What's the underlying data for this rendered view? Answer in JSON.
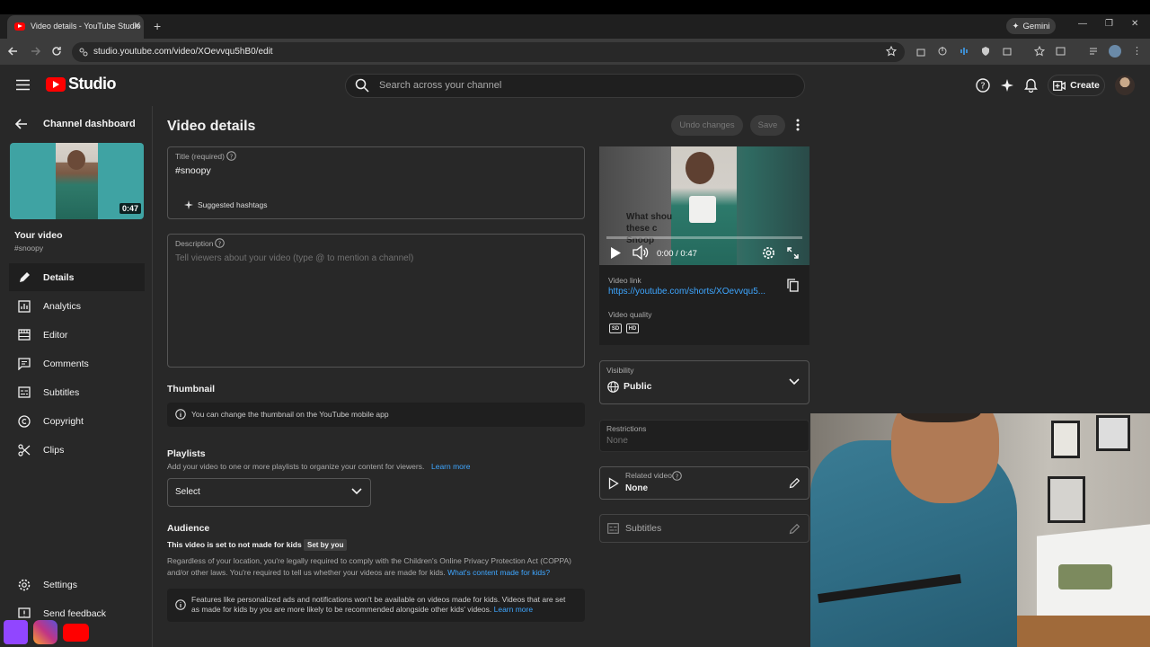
{
  "browser": {
    "tab_title": "Video details - YouTube Studio",
    "url": "studio.youtube.com/video/XOevvqu5hB0/edit",
    "gemini_label": "Gemini"
  },
  "header": {
    "logo_text": "Studio",
    "search_placeholder": "Search across your channel",
    "create_label": "Create"
  },
  "sidebar": {
    "back_label": "Channel dashboard",
    "thumb_duration": "0:47",
    "your_video": "Your video",
    "video_title": "#snoopy",
    "items": [
      {
        "label": "Details",
        "icon": "pencil-icon",
        "active": true
      },
      {
        "label": "Analytics",
        "icon": "analytics-icon"
      },
      {
        "label": "Editor",
        "icon": "editor-icon"
      },
      {
        "label": "Comments",
        "icon": "comments-icon"
      },
      {
        "label": "Subtitles",
        "icon": "subtitles-icon"
      },
      {
        "label": "Copyright",
        "icon": "copyright-icon"
      },
      {
        "label": "Clips",
        "icon": "scissors-icon"
      }
    ],
    "settings": "Settings",
    "feedback": "Send feedback"
  },
  "main": {
    "page_title": "Video details",
    "undo": "Undo changes",
    "save": "Save",
    "title_label": "Title (required)",
    "title_value": "#snoopy",
    "suggested_hashtags": "Suggested hashtags",
    "description_label": "Description",
    "description_placeholder": "Tell viewers about your video (type @ to mention a channel)",
    "thumbnail_heading": "Thumbnail",
    "thumbnail_info": "You can change the thumbnail on the YouTube mobile app",
    "playlists_heading": "Playlists",
    "playlists_desc": "Add your video to one or more playlists to organize your content for viewers.",
    "playlists_learn_more": "Learn more",
    "playlists_select": "Select",
    "audience_heading": "Audience",
    "audience_status": "This video is set to not made for kids",
    "audience_badge": "Set by you",
    "audience_p1": "Regardless of your location, you're legally required to comply with the Children's Online Privacy Protection Act (COPPA) and/or other laws. You're required to tell us whether your videos are made for kids.",
    "audience_p1_link": "What's content made for kids?",
    "audience_info": "Features like personalized ads and notifications won't be available on videos made for kids. Videos that are set as made for kids by you are more likely to be recommended alongside other kids' videos.",
    "audience_info_link": "Learn more"
  },
  "right": {
    "player_time": "0:00 / 0:47",
    "player_caption": "What shou these c Snoop",
    "video_link_label": "Video link",
    "video_link": "https://youtube.com/shorts/XOevvqu5...",
    "video_quality_label": "Video quality",
    "quality_badges": [
      "SD",
      "HD"
    ],
    "visibility_label": "Visibility",
    "visibility_value": "Public",
    "restrictions_label": "Restrictions",
    "restrictions_value": "None",
    "related_label": "Related video",
    "related_value": "None",
    "subtitles_label": "Subtitles"
  },
  "colors": {
    "bg": "#282828",
    "panel": "#1f1f1f",
    "link": "#3ea6ff",
    "brand_red": "#ff0000"
  }
}
